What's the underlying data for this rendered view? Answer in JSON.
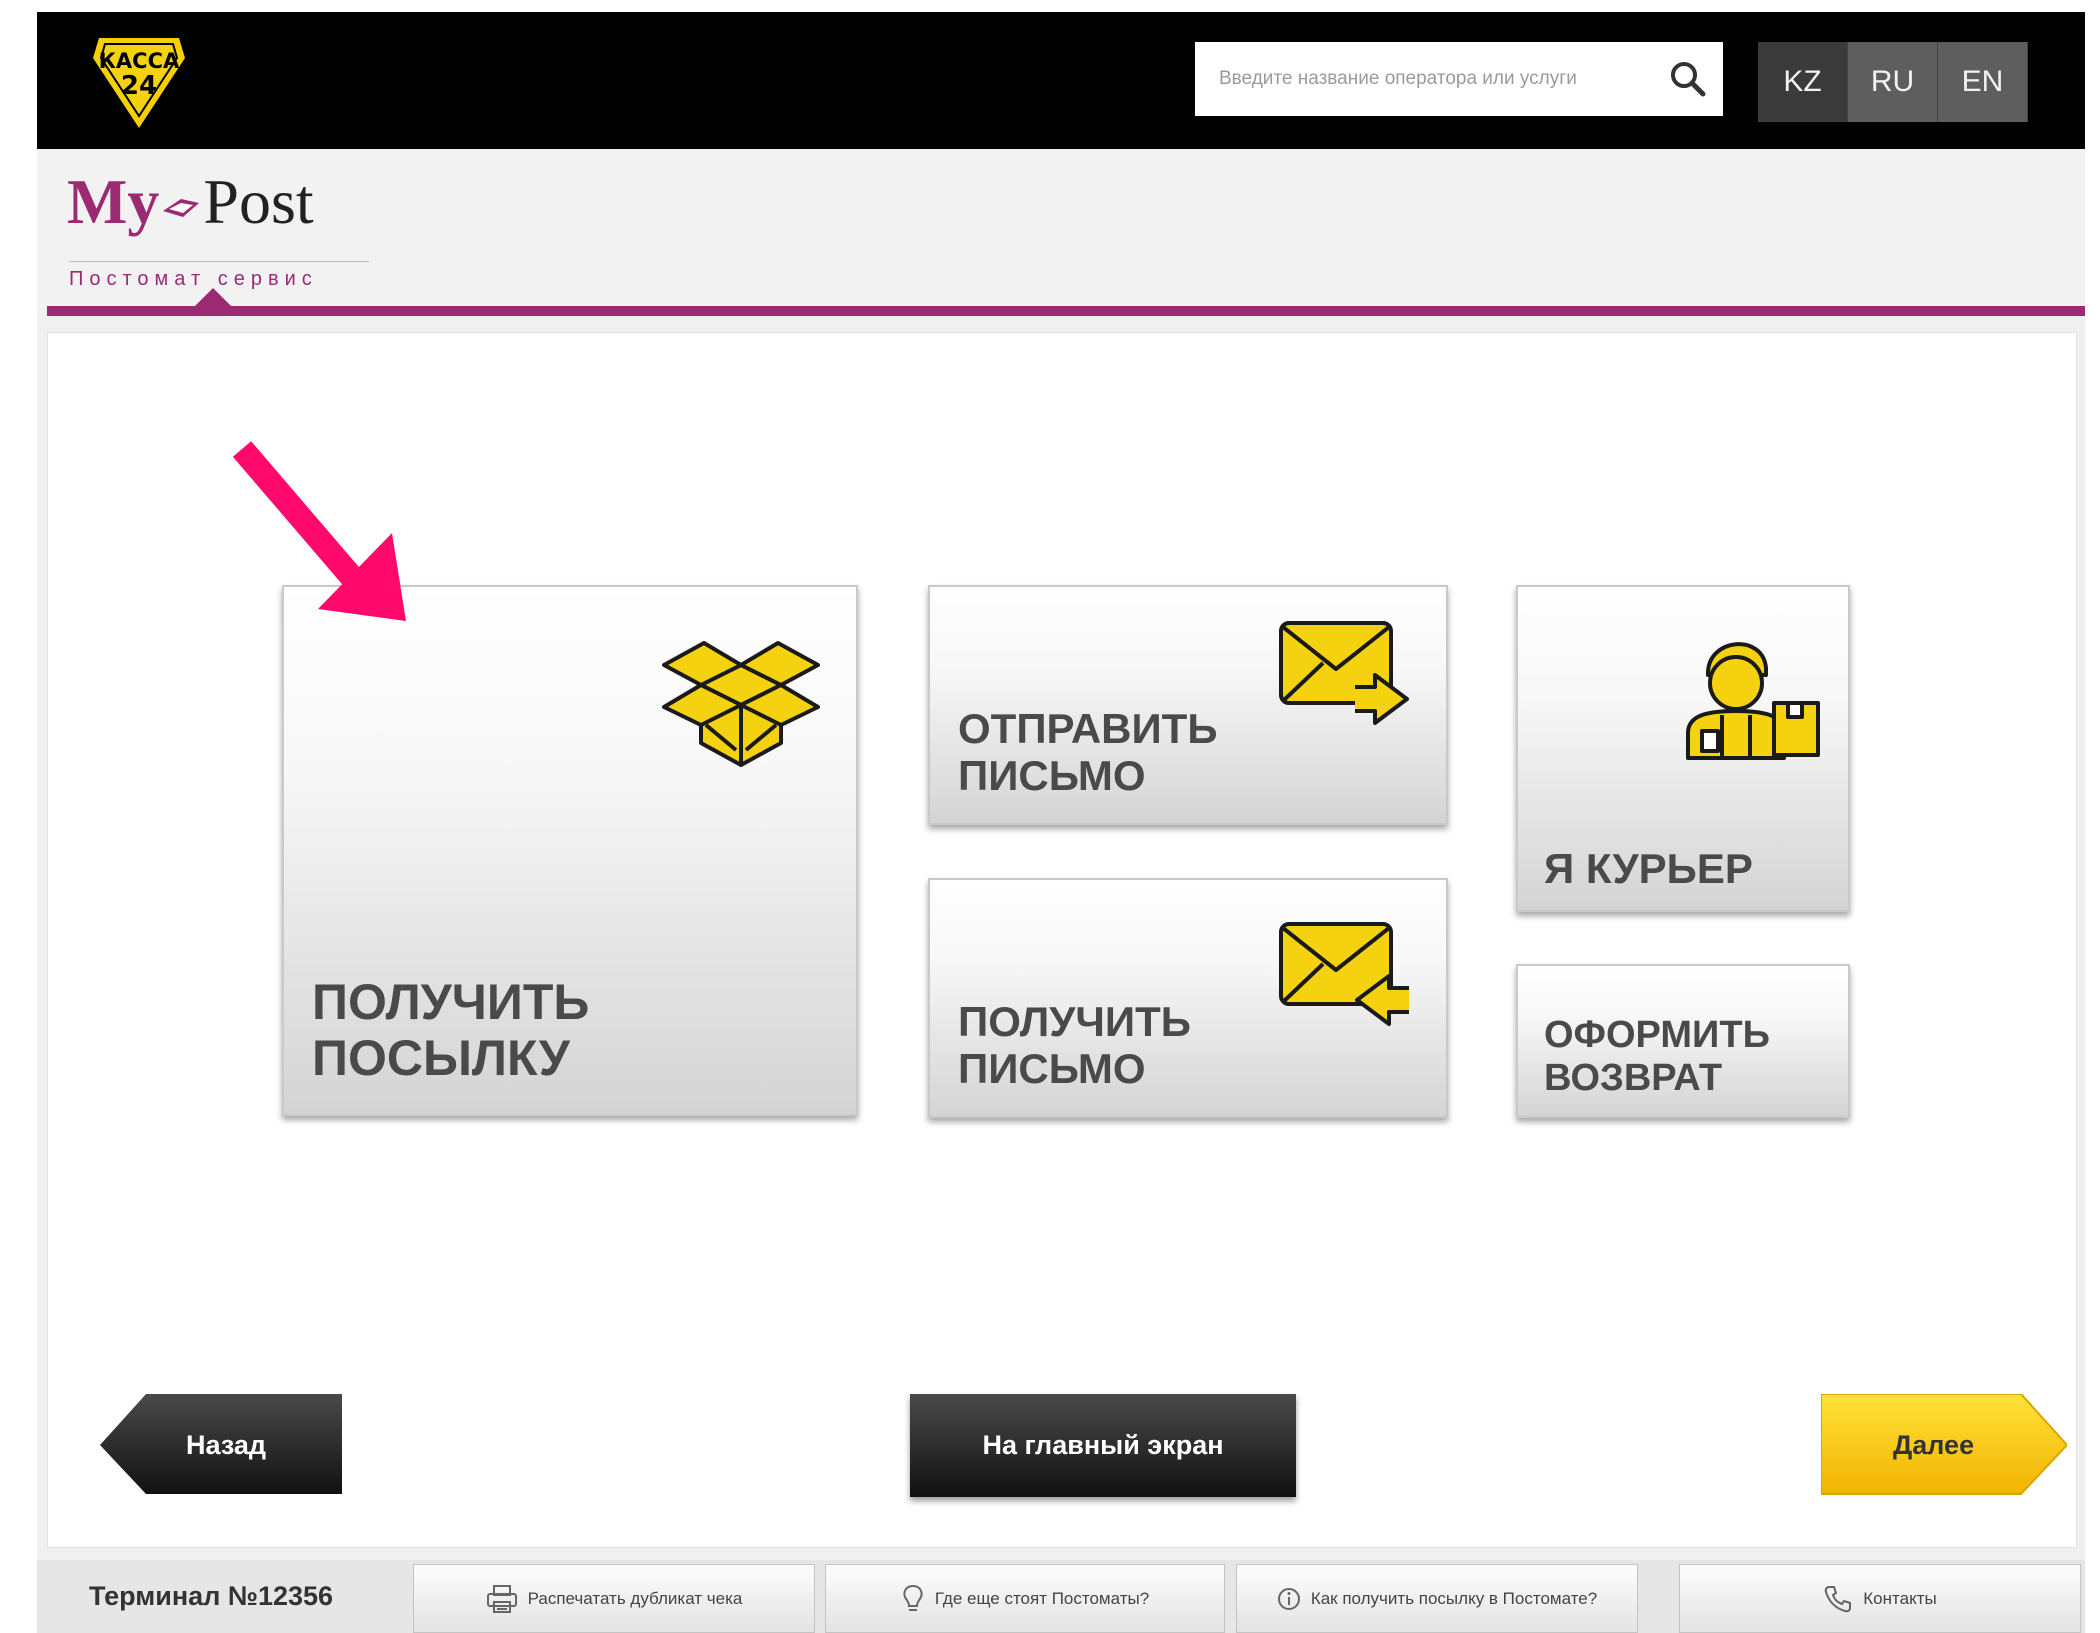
{
  "topbar": {
    "logo_line1": "КАССА",
    "logo_line2": "24",
    "search_placeholder": "Введите название оператора или услуги",
    "languages": [
      "KZ",
      "RU",
      "EN"
    ],
    "active_language": "KZ"
  },
  "brand": {
    "title_my": "My",
    "title_post": "Post",
    "subtitle": "Постомат сервис",
    "accent_color": "#9b2a73"
  },
  "tiles": {
    "get_parcel": "ПОЛУЧИТЬ\nПОСЫЛКУ",
    "send_letter": "ОТПРАВИТЬ\nПИСЬМО",
    "get_letter": "ПОЛУЧИТЬ\nПИСЬМО",
    "courier": "Я КУРЬЕР",
    "return": "ОФОРМИТЬ\nВОЗВРАТ",
    "icon_color": "#f5d20f"
  },
  "nav": {
    "back": "Назад",
    "home": "На главный экран",
    "next": "Далее"
  },
  "footer": {
    "terminal": "Терминал №12356",
    "print_receipt": "Распечатать дубликат чека",
    "where_postomats": "Где еще стоят Постоматы?",
    "how_to_get": "Как получить посылку в Постомате?",
    "contacts": "Контакты"
  },
  "annotation": {
    "arrow_color": "#ff0a6c"
  }
}
